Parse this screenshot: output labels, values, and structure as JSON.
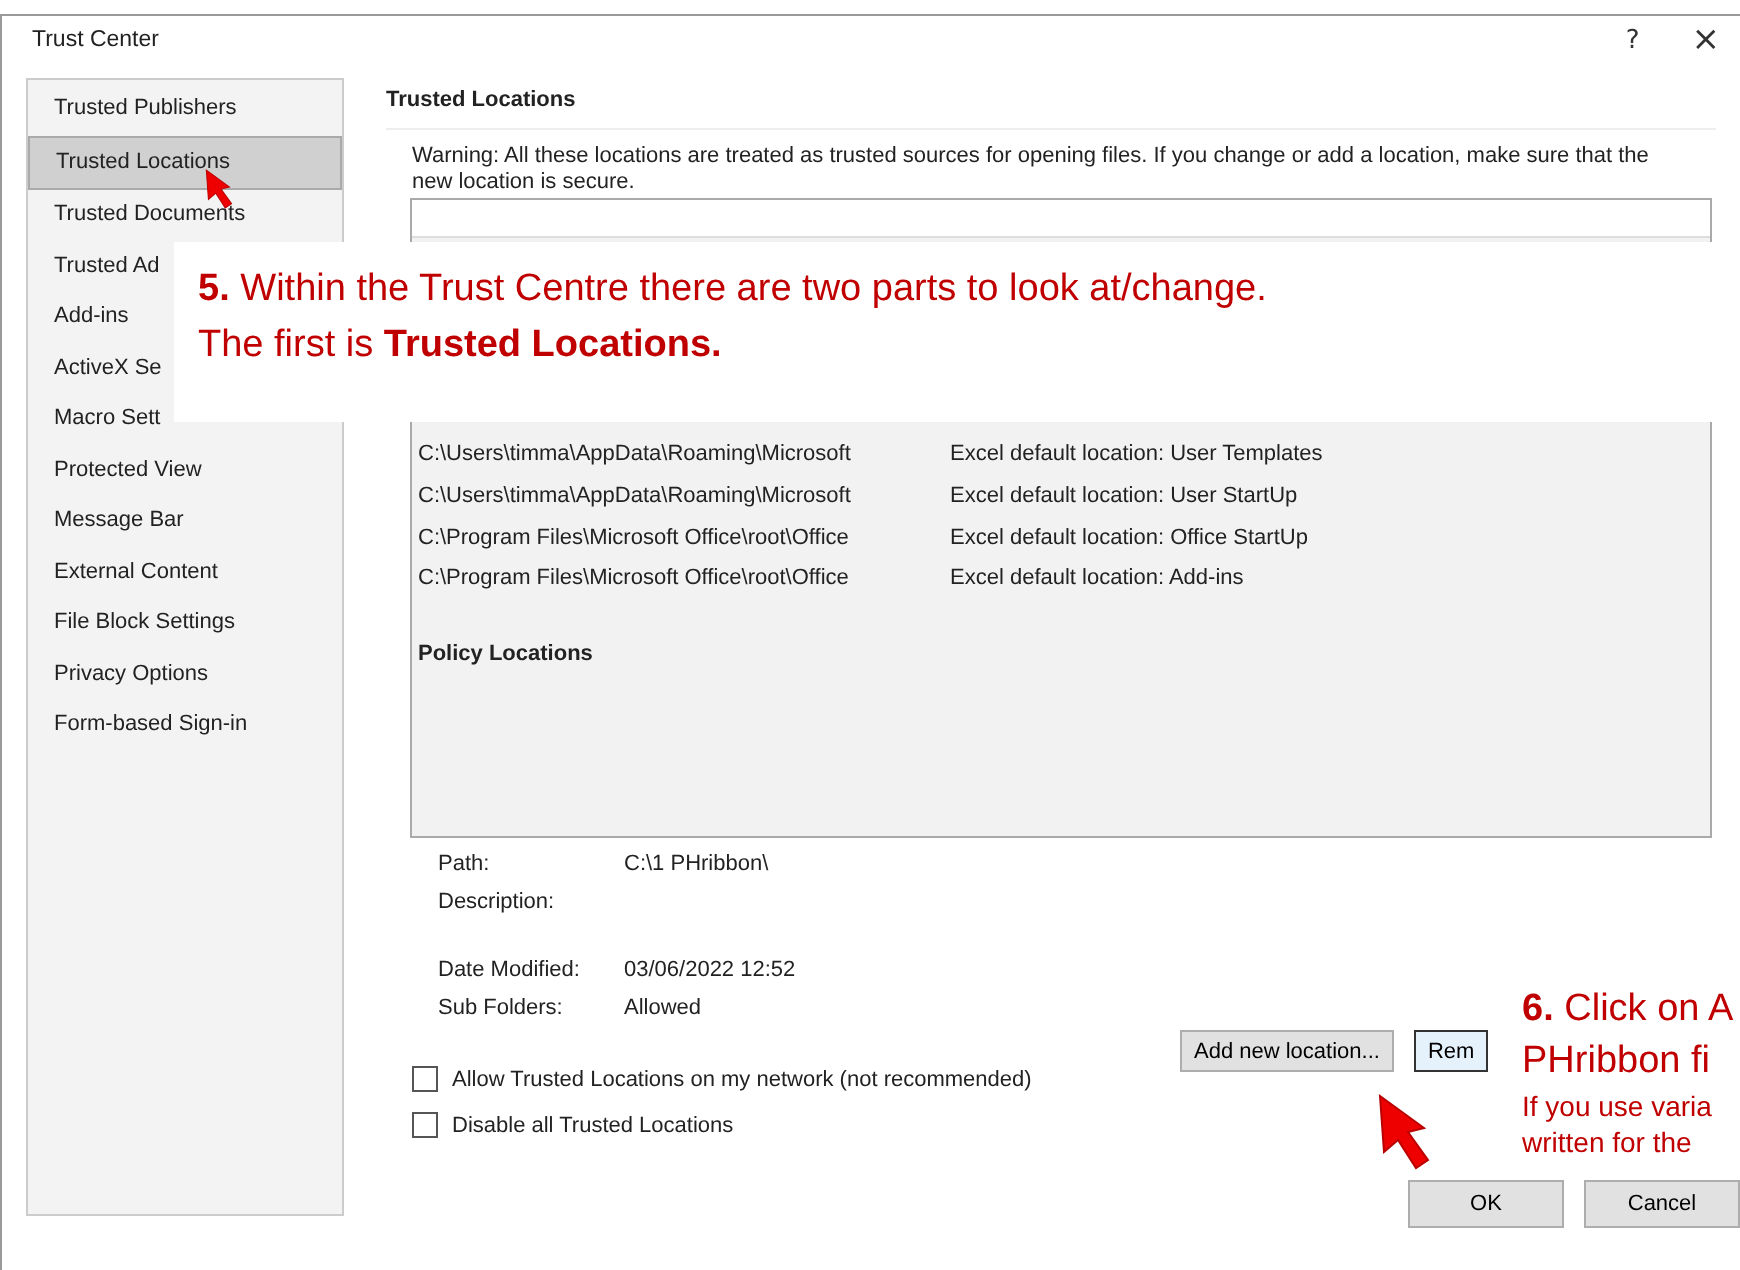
{
  "window": {
    "title": "Trust Center",
    "help": "?",
    "close": "×"
  },
  "sidebar": {
    "items": [
      {
        "label": "Trusted Publishers",
        "selected": false
      },
      {
        "label": "Trusted Locations",
        "selected": true
      },
      {
        "label": "Trusted Documents",
        "selected": false
      },
      {
        "label": "Trusted Ad",
        "selected": false
      },
      {
        "label": "Add-ins",
        "selected": false
      },
      {
        "label": "ActiveX Se",
        "selected": false
      },
      {
        "label": "Macro Sett",
        "selected": false
      },
      {
        "label": "Protected View",
        "selected": false
      },
      {
        "label": "Message Bar",
        "selected": false
      },
      {
        "label": "External Content",
        "selected": false
      },
      {
        "label": "File Block Settings",
        "selected": false
      },
      {
        "label": "Privacy Options",
        "selected": false
      },
      {
        "label": "Form-based Sign-in",
        "selected": false
      }
    ]
  },
  "section_title": "Trusted Locations",
  "warning": "Warning: All these locations are treated as trusted sources for opening files.  If you change or add a location, make sure that the new location is secure.",
  "table": {
    "rows": [
      {
        "path": "C:\\Users\\timma\\AppData\\Roaming\\Microsoft",
        "description": "Excel default location: User Templates"
      },
      {
        "path": "C:\\Users\\timma\\AppData\\Roaming\\Microsoft",
        "description": "Excel default location: User StartUp"
      },
      {
        "path": "C:\\Program Files\\Microsoft Office\\root\\Office",
        "description": "Excel default location: Office StartUp"
      },
      {
        "path": "C:\\Program Files\\Microsoft Office\\root\\Office",
        "description": "Excel default location: Add-ins"
      }
    ],
    "policy_heading": "Policy Locations"
  },
  "details": [
    {
      "label": "Path:",
      "value": "C:\\1 PHribbon\\"
    },
    {
      "label": "Description:"
    },
    {
      "label": "Date Modified:",
      "value": "03/06/2022 12:52"
    },
    {
      "label": "Sub Folders:",
      "value": "Allowed"
    }
  ],
  "buttons": [
    "Add new location...",
    "Rem"
  ],
  "options": [
    {
      "label": "Allow Trusted Locations on my network (not recommended)",
      "checked": false
    },
    {
      "label": "Disable all Trusted Locations",
      "checked": false
    }
  ],
  "footer_buttons": [
    "OK",
    "Cancel"
  ],
  "callouts": [
    {
      "lines": [
        {
          "kind": "heading",
          "text": "**5.** Within the Trust Centre there are two parts to look at/change."
        },
        {
          "kind": "heading",
          "text": "The first is **Trusted Locations.**"
        }
      ]
    },
    {
      "lines": [
        {
          "kind": "heading",
          "text": "**6.** Click on A"
        },
        {
          "kind": "heading",
          "text": "PHribbon fi"
        },
        {
          "kind": "note",
          "text": "If you use varia"
        },
        {
          "kind": "note",
          "text": "written for the"
        }
      ]
    }
  ]
}
